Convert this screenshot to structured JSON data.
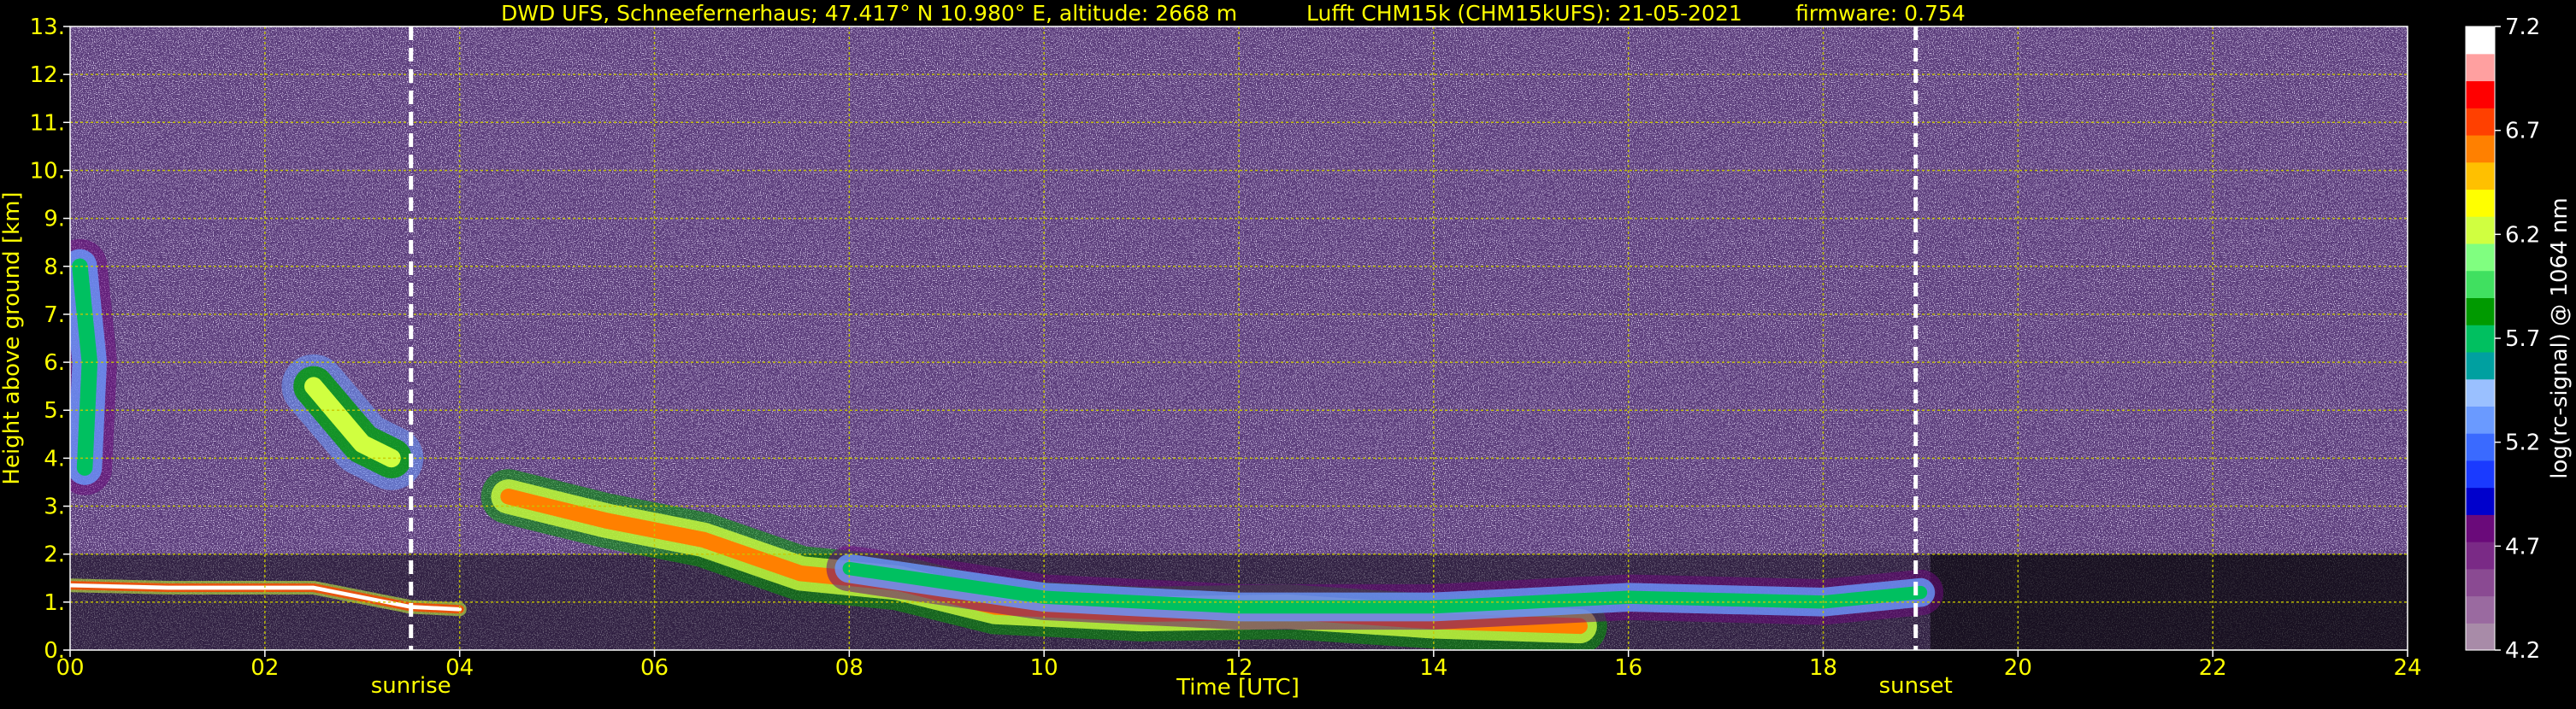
{
  "header": {
    "station": "DWD UFS, Schneefernerhaus; 47.417° N 10.980° E, altitude: 2668 m",
    "instrument": "Lufft CHM15k (CHM15kUFS): 21-05-2021",
    "firmware": "firmware: 0.754"
  },
  "colors": {
    "background": "#000000",
    "text": "#ffff00",
    "grid": "#c8c800",
    "event_line": "#ffffff",
    "noise_base": "#6a4a8a"
  },
  "chart_data": {
    "type": "heatmap",
    "xlabel": "Time [UTC]",
    "ylabel": "Height above ground [km]",
    "xlim": [
      0,
      24
    ],
    "ylim": [
      0,
      13
    ],
    "x_ticks": [
      0,
      2,
      4,
      6,
      8,
      10,
      12,
      14,
      16,
      18,
      20,
      22,
      24
    ],
    "x_tick_labels": [
      "00",
      "02",
      "04",
      "06",
      "08",
      "10",
      "12",
      "14",
      "16",
      "18",
      "20",
      "22",
      "24"
    ],
    "y_ticks": [
      0,
      1,
      2,
      3,
      4,
      5,
      6,
      7,
      8,
      9,
      10,
      11,
      12,
      13
    ],
    "y_tick_labels": [
      "0.",
      "1.",
      "2.",
      "3.",
      "4.",
      "5.",
      "6.",
      "7.",
      "8.",
      "9.",
      "10.",
      "11.",
      "12.",
      "13."
    ],
    "grid": true,
    "events": [
      {
        "label": "sunrise",
        "time": 3.5
      },
      {
        "label": "sunset",
        "time": 18.95
      }
    ],
    "colorbar": {
      "label": "log(rc-signal) @ 1064 nm",
      "min": 4.2,
      "max": 7.2,
      "tick_values": [
        4.2,
        4.7,
        5.2,
        5.7,
        6.2,
        6.7,
        7.2
      ],
      "tick_labels": [
        "4.2",
        "4.7",
        "5.2",
        "5.7",
        "6.2",
        "6.7",
        "7.2"
      ],
      "colors": [
        "#a88ba8",
        "#9a6aa0",
        "#8a4a92",
        "#7a2a86",
        "#6a0a7a",
        "#0000cc",
        "#1a3aff",
        "#3a6aff",
        "#6a9aff",
        "#9ac0ff",
        "#00a0a0",
        "#00c060",
        "#009a00",
        "#40e060",
        "#80ff80",
        "#d0ff40",
        "#ffff00",
        "#ffc000",
        "#ff8000",
        "#ff4000",
        "#ff0000",
        "#ffa0a0",
        "#ffffff"
      ]
    },
    "layers": [
      {
        "name": "",
        "segments": [
          [
            0.0,
            1.35
          ],
          [
            1.0,
            1.3
          ],
          [
            2.5,
            1.3
          ],
          [
            3.5,
            0.9
          ],
          [
            4.0,
            0.85
          ]
        ],
        "level": 7.2,
        "thickness_km": 0.15
      },
      {
        "name": "",
        "segments": [
          [
            4.5,
            3.2
          ],
          [
            5.5,
            2.7
          ],
          [
            6.5,
            2.3
          ],
          [
            7.5,
            1.6
          ],
          [
            8.5,
            1.4
          ],
          [
            9.5,
            0.9
          ],
          [
            11.0,
            0.75
          ],
          [
            12.5,
            0.8
          ],
          [
            14.0,
            0.6
          ],
          [
            15.5,
            0.5
          ]
        ],
        "level": 6.7,
        "thickness_km": 0.6
      },
      {
        "name": "",
        "segments": [
          [
            8.0,
            1.7
          ],
          [
            9.0,
            1.4
          ],
          [
            10.0,
            1.1
          ],
          [
            12.0,
            0.9
          ],
          [
            14.0,
            0.9
          ],
          [
            16.0,
            1.1
          ],
          [
            18.0,
            1.0
          ],
          [
            19.0,
            1.2
          ]
        ],
        "level": 5.7,
        "thickness_km": 0.5
      },
      {
        "name": "",
        "segments": [
          [
            2.5,
            5.5
          ],
          [
            3.0,
            4.3
          ],
          [
            3.3,
            4.0
          ]
        ],
        "level": 6.2,
        "thickness_km": 0.7
      },
      {
        "name": "",
        "segments": [
          [
            0.1,
            8.0
          ],
          [
            0.2,
            6.0
          ],
          [
            0.15,
            3.8
          ]
        ],
        "level": 5.7,
        "thickness_km": 0.6
      }
    ]
  }
}
